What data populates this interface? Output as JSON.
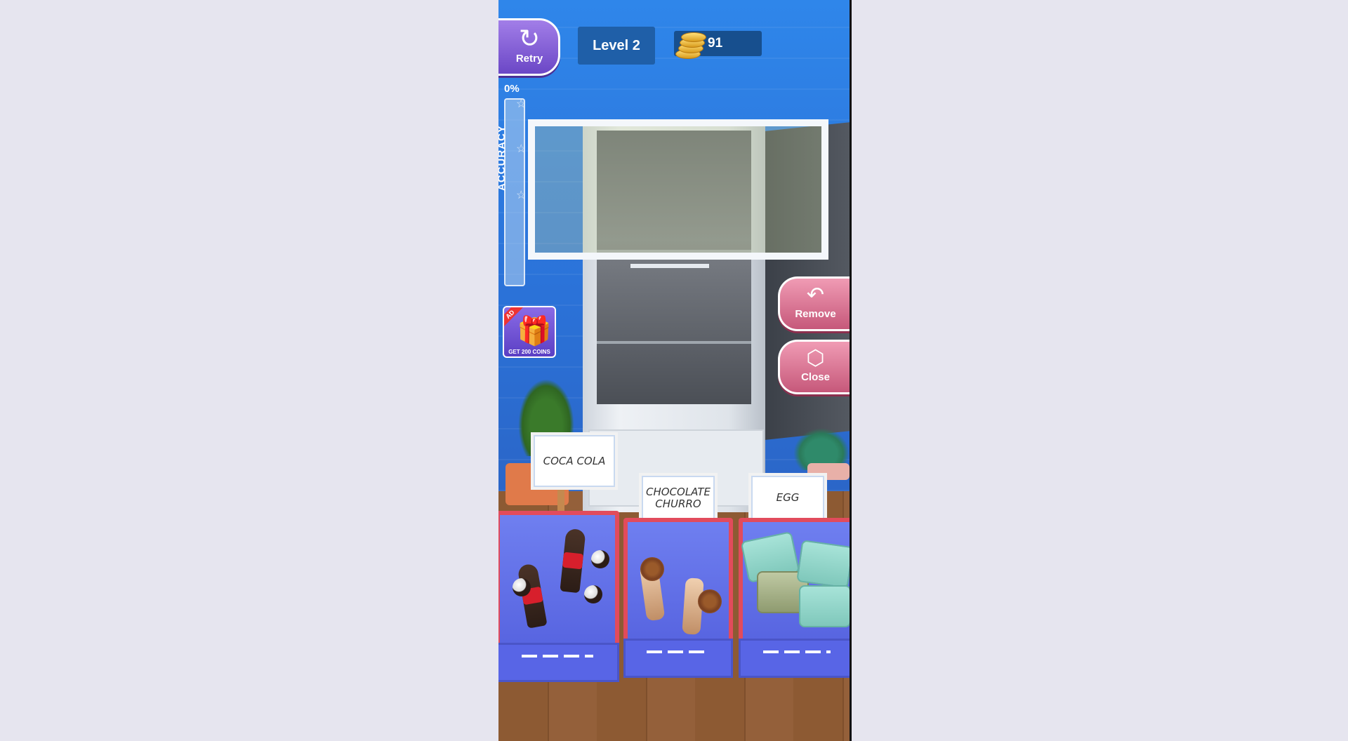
{
  "hud": {
    "retry_label": "Retry",
    "level_label": "Level 2",
    "coins": "91",
    "accuracy_percent": "0%",
    "accuracy_label": "ACCURACY",
    "gift_ad_tag": "AD",
    "gift_caption": "GET 200 COINS"
  },
  "actions": {
    "remove_label": "Remove",
    "close_label": "Close"
  },
  "bins": [
    {
      "label": "COCA COLA"
    },
    {
      "label": "CHOCOLATE CHURRO"
    },
    {
      "label": "EGG"
    }
  ],
  "icons": {
    "retry": "refresh-icon",
    "remove": "undo-arrow-icon",
    "close": "box-icon",
    "coins": "coin-stack-icon",
    "gift": "gift-icon",
    "star": "star-icon"
  },
  "colors": {
    "retry_button": "#7b55d4",
    "side_button": "#d96f90",
    "level_bg": "#1f5fa8",
    "bin_border": "#e24b5c",
    "bin_body": "#5f6ee6"
  }
}
